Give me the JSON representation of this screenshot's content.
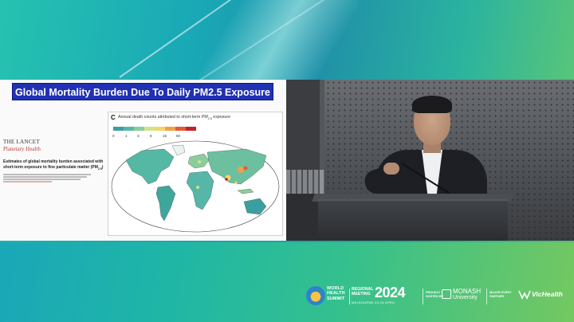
{
  "slide": {
    "title": "Global Mortality Burden Due To Daily PM2.5 Exposure",
    "lancet_name": "THE LANCET",
    "lancet_journal": "Planetary Health",
    "description_line1": "Estimates of global mortality burden associated with",
    "description_line2": "short-term exposure to fine particulate matter (PM",
    "description_sub": "2.5",
    "description_end": ")",
    "figure": {
      "panel_letter": "C",
      "title_prefix": "Annual death counts attributed to short-term PM",
      "title_sub": "2.5",
      "title_suffix": " exposure",
      "legend_colors": [
        "#3b9fa0",
        "#56b7a8",
        "#8ccd9c",
        "#cfe38a",
        "#f3d565",
        "#f0a04b",
        "#e55a36",
        "#c2212b"
      ],
      "legend_ticks": [
        "0",
        "1",
        "3",
        "8",
        "15",
        "50"
      ]
    }
  },
  "footer": {
    "whs_line1": "WORLD",
    "whs_line2": "HEALTH",
    "whs_line3": "SUMMIT",
    "rm_line1": "REGIONAL",
    "rm_line2": "MEETING",
    "year": "2024",
    "venue": "MELBOURNE 23-24 APRIL",
    "hosted_line1": "PROUDLY",
    "hosted_line2": "HOSTED BY",
    "monash_line1": "MONASH",
    "monash_line2": "University",
    "major_line1": "MAJOR EVENT",
    "major_line2": "PARTNER",
    "vic": "VicHealth"
  },
  "colors": {
    "slide_title_bg": "#2131b3",
    "accent": "#1fb3a6"
  }
}
